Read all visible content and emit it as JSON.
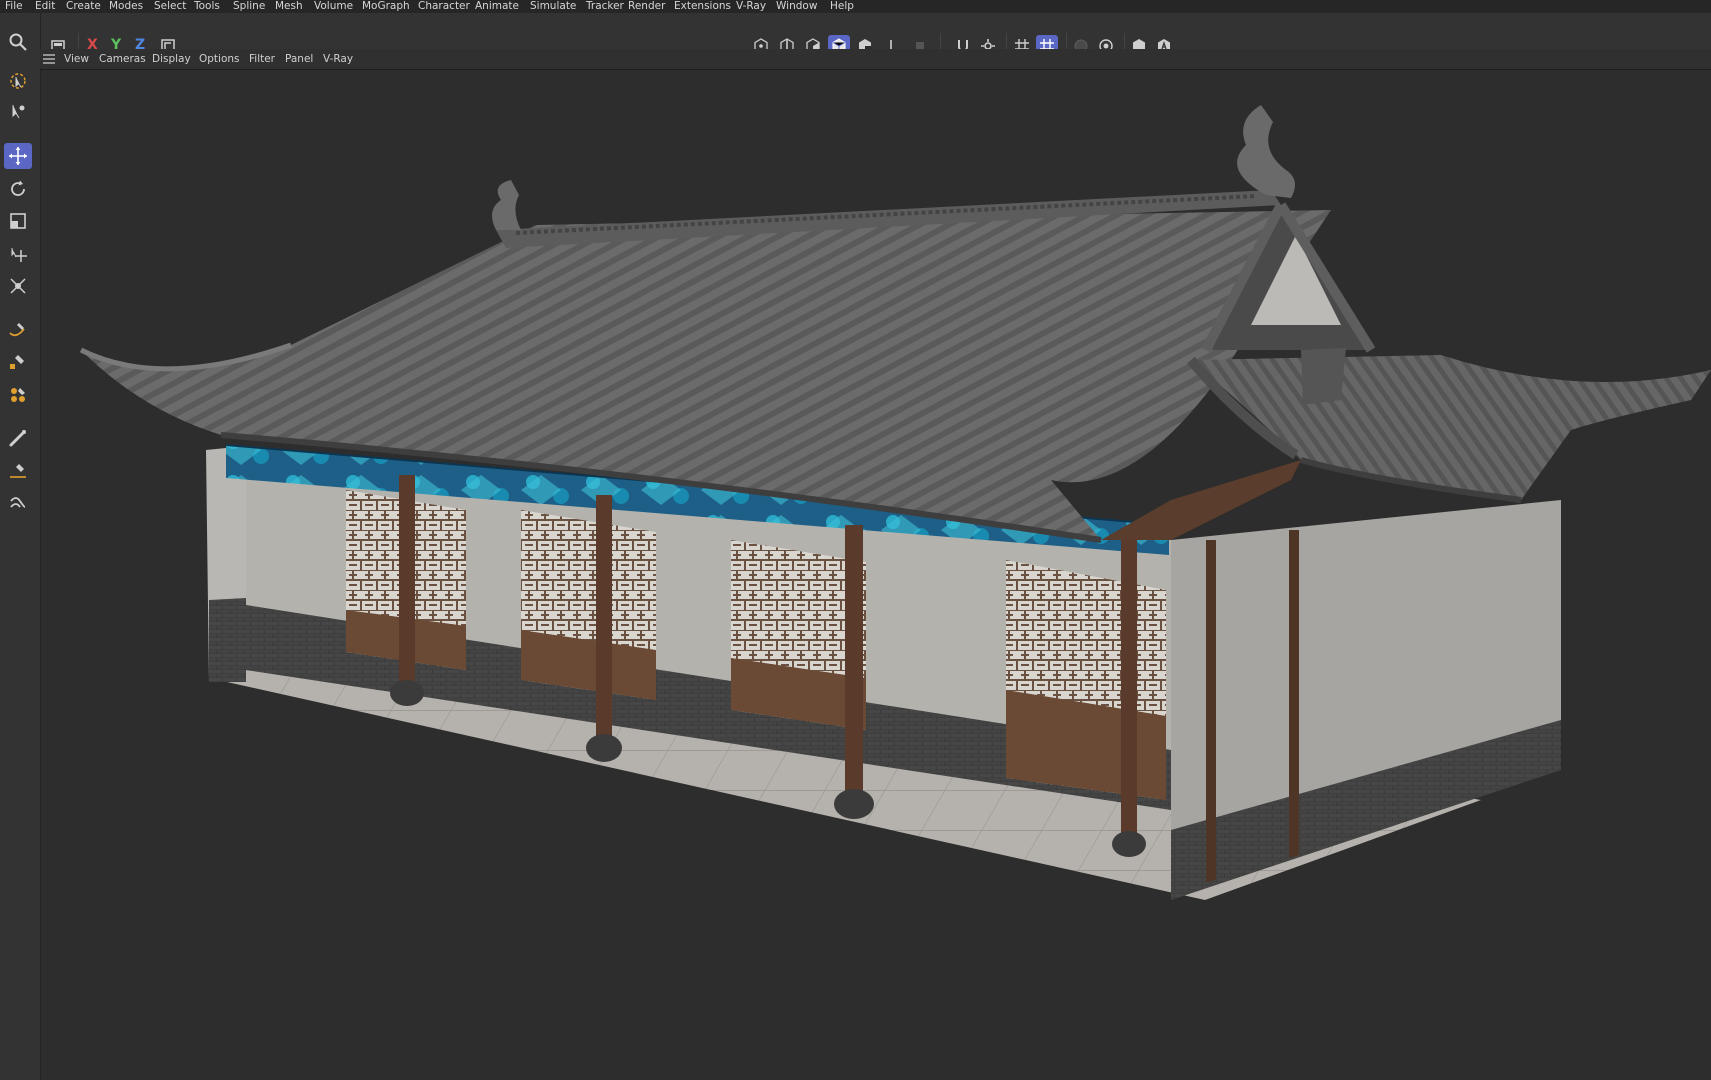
{
  "menu": {
    "items": [
      "File",
      "Edit",
      "Create",
      "Modes",
      "Select",
      "Tools",
      "Spline",
      "Mesh",
      "Volume",
      "MoGraph",
      "Character",
      "Animate",
      "Simulate",
      "Tracker",
      "Render",
      "Extensions",
      "V-Ray",
      "Window",
      "Help"
    ]
  },
  "toolbar": {
    "axis": {
      "x": "X",
      "y": "Y",
      "z": "Z"
    },
    "axis_colors": {
      "x": "#d94b4b",
      "y": "#5fbf5f",
      "z": "#4f86e0"
    },
    "icons": [
      "undo-view-icon",
      "lock-axis-x",
      "lock-axis-y",
      "lock-axis-z",
      "coordinate-system-icon",
      "points-mode-icon",
      "edges-mode-icon",
      "polygons-mode-icon",
      "model-mode-icon",
      "uvw-mode-icon",
      "axis-mode-icon",
      "tweak-icon",
      "snap-magnet-icon",
      "snap-settings-icon",
      "workplane-grid-icon",
      "workplane-snap-icon",
      "render-region-icon",
      "render-view-icon",
      "vray-render-icon",
      "vray-ipr-icon"
    ]
  },
  "viewport_menu": {
    "items": [
      "View",
      "Cameras",
      "Display",
      "Options",
      "Filter",
      "Panel",
      "V-Ray"
    ]
  },
  "left_tools": [
    "live-selection-icon",
    "active-tool-icon",
    "move-icon",
    "rotate-icon",
    "scale-icon",
    "move-object-icon",
    "transform-icon",
    "spline-pen-icon",
    "sketch-icon",
    "spline-smooth-icon",
    "brush-icon",
    "knife-icon",
    "bridge-icon"
  ],
  "colors": {
    "accent": "#5a67c4",
    "viewport_bg": "#2d2d2d"
  }
}
